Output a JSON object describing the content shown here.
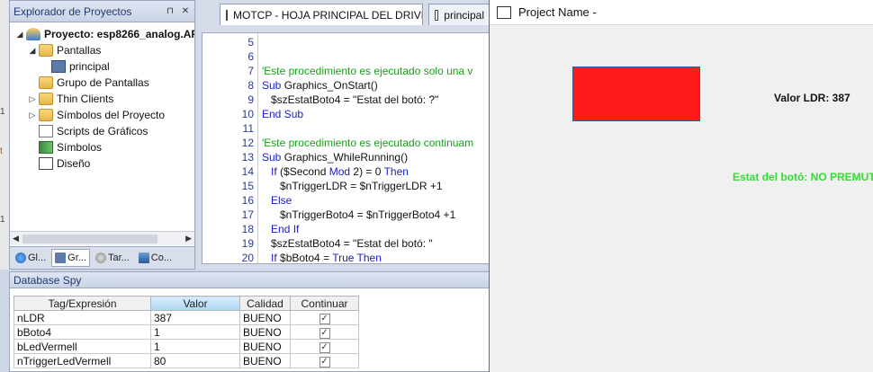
{
  "explorer": {
    "title": "Explorador de Proyectos",
    "pin_glyph": "⊓",
    "close_glyph": "✕",
    "tree": [
      {
        "label": "Proyecto: esp8266_analog.AP",
        "level": 0,
        "icon": "project-icon",
        "bold": true,
        "arrow": "◢"
      },
      {
        "label": "Pantallas",
        "level": 1,
        "icon": "folder-icon",
        "arrow": "◢"
      },
      {
        "label": "principal",
        "level": 2,
        "icon": "screen-icon",
        "arrow": ""
      },
      {
        "label": "Grupo de Pantallas",
        "level": 1,
        "icon": "folder-icon",
        "arrow": ""
      },
      {
        "label": "Thin Clients",
        "level": 1,
        "icon": "folder-icon",
        "arrow": "▷"
      },
      {
        "label": "Símbolos del Proyecto",
        "level": 1,
        "icon": "folder-icon",
        "arrow": "▷"
      },
      {
        "label": "Scripts de Gráficos",
        "level": 1,
        "icon": "script-icon",
        "arrow": ""
      },
      {
        "label": "Símbolos",
        "level": 1,
        "icon": "symbols-icon",
        "arrow": ""
      },
      {
        "label": "Diseño",
        "level": 1,
        "icon": "design-icon",
        "arrow": ""
      }
    ],
    "bottom_tabs": [
      "Gl...",
      "Gr...",
      "Tar...",
      "Co..."
    ]
  },
  "editor": {
    "tabs": [
      "MOTCP - HOJA PRINCIPAL DEL DRIVER",
      "principal"
    ],
    "lines": [
      {
        "n": "5",
        "parts": []
      },
      {
        "n": "6",
        "parts": []
      },
      {
        "n": "7",
        "parts": [
          {
            "t": "'Este procedimiento es ejecutado solo una v",
            "c": "cmt"
          }
        ]
      },
      {
        "n": "8",
        "parts": [
          {
            "t": "Sub",
            "c": "kw"
          },
          {
            "t": " Graphics_OnStart()",
            "c": ""
          }
        ]
      },
      {
        "n": "9",
        "parts": [
          {
            "t": "   $szEstatBoto4 = \"Estat del botó: ?\"",
            "c": ""
          }
        ]
      },
      {
        "n": "10",
        "parts": [
          {
            "t": "End Sub",
            "c": "kw"
          }
        ]
      },
      {
        "n": "11",
        "parts": []
      },
      {
        "n": "12",
        "parts": [
          {
            "t": "'Este procedimiento es ejecutado continuam",
            "c": "cmt"
          }
        ]
      },
      {
        "n": "13",
        "parts": [
          {
            "t": "Sub",
            "c": "kw"
          },
          {
            "t": " Graphics_WhileRunning()",
            "c": ""
          }
        ]
      },
      {
        "n": "14",
        "parts": [
          {
            "t": "   ",
            "c": ""
          },
          {
            "t": "If",
            "c": "kw"
          },
          {
            "t": " ($Second ",
            "c": ""
          },
          {
            "t": "Mod",
            "c": "kw"
          },
          {
            "t": " 2) = 0 ",
            "c": ""
          },
          {
            "t": "Then",
            "c": "kw"
          }
        ]
      },
      {
        "n": "15",
        "parts": [
          {
            "t": "      $nTriggerLDR = $nTriggerLDR +1",
            "c": ""
          }
        ]
      },
      {
        "n": "16",
        "parts": [
          {
            "t": "   ",
            "c": ""
          },
          {
            "t": "Else",
            "c": "kw"
          }
        ]
      },
      {
        "n": "17",
        "parts": [
          {
            "t": "      $nTriggerBoto4 = $nTriggerBoto4 +1",
            "c": ""
          }
        ]
      },
      {
        "n": "18",
        "parts": [
          {
            "t": "   ",
            "c": ""
          },
          {
            "t": "End If",
            "c": "kw"
          }
        ]
      },
      {
        "n": "19",
        "parts": [
          {
            "t": "   $szEstatBoto4 = \"Estat del botó: \"",
            "c": ""
          }
        ]
      },
      {
        "n": "20",
        "parts": [
          {
            "t": "   ",
            "c": ""
          },
          {
            "t": "If",
            "c": "kw"
          },
          {
            "t": " $bBoto4 = ",
            "c": ""
          },
          {
            "t": "True",
            "c": "kw"
          },
          {
            "t": " ",
            "c": ""
          },
          {
            "t": "Then",
            "c": "kw"
          }
        ]
      }
    ]
  },
  "spy": {
    "title": "Database Spy",
    "columns": [
      "Tag/Expresión",
      "Valor",
      "Calidad",
      "Continuar"
    ],
    "rows": [
      {
        "tag": "nLDR",
        "value": "387",
        "quality": "BUENO",
        "continue": true
      },
      {
        "tag": "bBoto4",
        "value": "1",
        "quality": "BUENO",
        "continue": true
      },
      {
        "tag": "bLedVermell",
        "value": "1",
        "quality": "BUENO",
        "continue": true
      },
      {
        "tag": "nTriggerLedVermell",
        "value": "80",
        "quality": "BUENO",
        "continue": true
      }
    ]
  },
  "runtime": {
    "title": "Project Name -",
    "ldr_label": "Valor LDR: 387",
    "button_state": "Estat del botó: NO PREMUT",
    "led_color": "#ff1a1a",
    "state_color": "#33dd33"
  }
}
